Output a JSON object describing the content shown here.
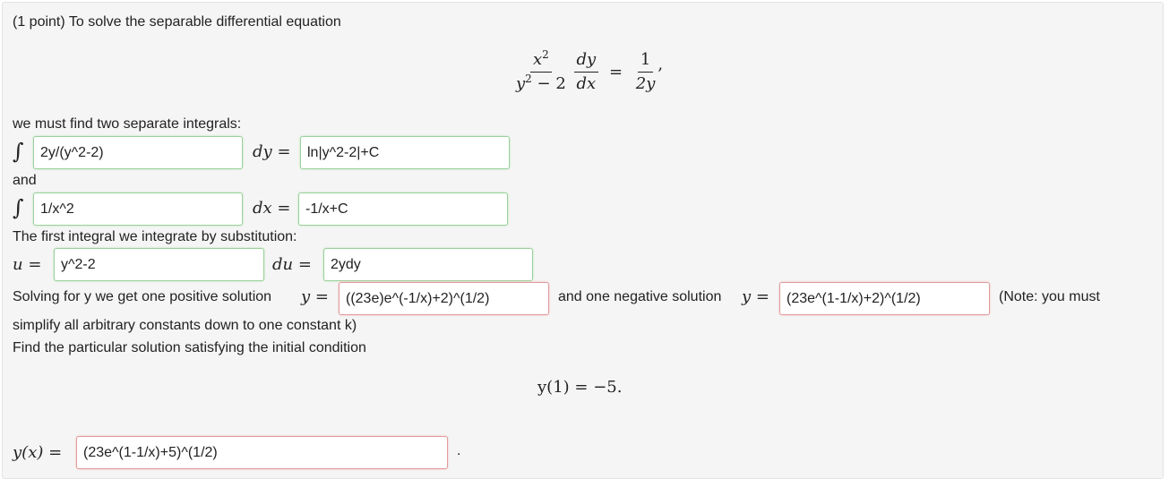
{
  "problem": {
    "intro": "(1 point) To solve the separable differential equation",
    "we_must": "we must find two separate integrals:",
    "and": "and",
    "substitution": "The first integral we integrate by substitution:",
    "solving_prefix": "Solving for y we get one positive solution",
    "negative_text": "and one negative solution",
    "note_text": "(Note: you must",
    "note_text2": "simplify all arbitrary constants down to one constant k)",
    "particular": "Find the particular solution satisfying the initial condition"
  },
  "equation": {
    "lhs_num": "x",
    "lhs_num_exp": "2",
    "lhs_den_var": "y",
    "lhs_den_exp": "2",
    "lhs_den_rest": " − 2",
    "deriv_num": "dy",
    "deriv_den": "dx",
    "eq": "=",
    "rhs_num": "1",
    "rhs_den": "2y",
    "trail": ","
  },
  "integral1": {
    "integrand": "2y/(y^2-2)",
    "diff": "dy",
    "eq": "=",
    "result": "ln|y^2-2|+C",
    "integrand_status": "correct",
    "result_status": "correct"
  },
  "integral2": {
    "integrand": "1/x^2",
    "diff": "dx",
    "eq": "=",
    "result": "-1/x+C",
    "integrand_status": "correct",
    "result_status": "correct"
  },
  "substitution_fields": {
    "u_label": "u =",
    "u_value": "y^2-2",
    "du_label": "du =",
    "du_value": "2ydy",
    "u_status": "correct",
    "du_status": "correct"
  },
  "solutions": {
    "y_label": "y =",
    "positive": "((23e)e^(-1/x)+2)^(1/2)",
    "negative": "(23e^(1-1/x)+2)^(1/2)",
    "positive_status": "incorrect",
    "negative_status": "incorrect"
  },
  "initial_condition": {
    "text": "y(1) = −5."
  },
  "particular_solution": {
    "label": "y(x) =",
    "value": "(23e^(1-1/x)+5)^(1/2)",
    "status": "incorrect",
    "trail": "."
  },
  "colors": {
    "correct_border": "#9bd19b",
    "incorrect_border": "#e29a9a",
    "panel_bg": "#f5f5f5"
  },
  "icons": {
    "integral_sign": "∫"
  }
}
